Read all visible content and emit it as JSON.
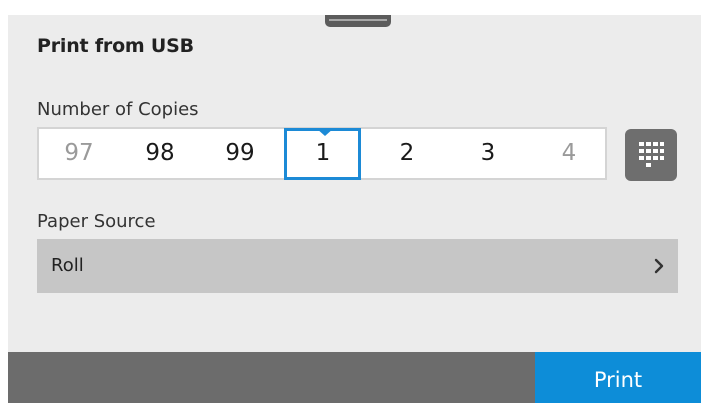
{
  "header": {
    "title": "Print from USB"
  },
  "copies": {
    "label": "Number of Copies",
    "visible_values": [
      "97",
      "98",
      "99",
      "1",
      "2",
      "3",
      "4"
    ],
    "selected_value": "1",
    "keypad_icon": "keypad-icon"
  },
  "paper_source": {
    "label": "Paper Source",
    "value": "Roll",
    "chevron_icon": "chevron-right-icon"
  },
  "actions": {
    "print_label": "Print"
  },
  "colors": {
    "accent": "#0d8dd8",
    "selection_border": "#1c8ad6",
    "background": "#ececec",
    "bottom_bar": "#6c6c6c"
  }
}
